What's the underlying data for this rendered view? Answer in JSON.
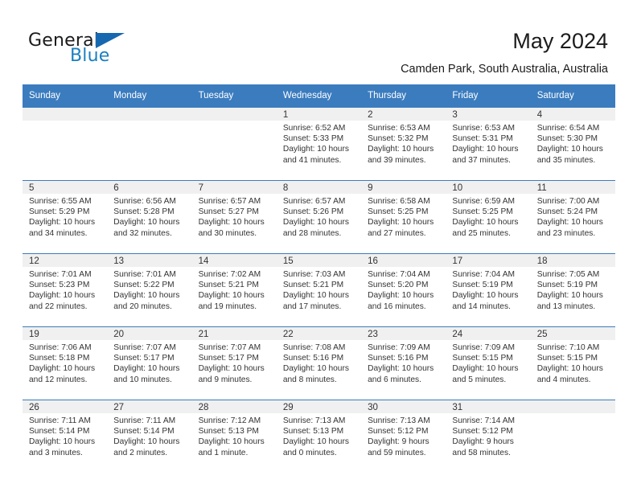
{
  "brand": {
    "word1": "General",
    "word2": "Blue",
    "triangle_color": "#1668b0",
    "blue_color": "#1a7fc1"
  },
  "header": {
    "title": "May 2024",
    "subtitle": "Camden Park, South Australia, Australia"
  },
  "theme": {
    "header_bar": "#3b7cbf",
    "daynum_band": "#f0f0f0",
    "text": "#333333"
  },
  "calendar": {
    "weekday_headers": [
      "Sunday",
      "Monday",
      "Tuesday",
      "Wednesday",
      "Thursday",
      "Friday",
      "Saturday"
    ],
    "weeks": [
      [
        {
          "day": "",
          "sunrise": "",
          "sunset": "",
          "daylight": ""
        },
        {
          "day": "",
          "sunrise": "",
          "sunset": "",
          "daylight": ""
        },
        {
          "day": "",
          "sunrise": "",
          "sunset": "",
          "daylight": ""
        },
        {
          "day": "1",
          "sunrise": "Sunrise: 6:52 AM",
          "sunset": "Sunset: 5:33 PM",
          "daylight": "Daylight: 10 hours and 41 minutes."
        },
        {
          "day": "2",
          "sunrise": "Sunrise: 6:53 AM",
          "sunset": "Sunset: 5:32 PM",
          "daylight": "Daylight: 10 hours and 39 minutes."
        },
        {
          "day": "3",
          "sunrise": "Sunrise: 6:53 AM",
          "sunset": "Sunset: 5:31 PM",
          "daylight": "Daylight: 10 hours and 37 minutes."
        },
        {
          "day": "4",
          "sunrise": "Sunrise: 6:54 AM",
          "sunset": "Sunset: 5:30 PM",
          "daylight": "Daylight: 10 hours and 35 minutes."
        }
      ],
      [
        {
          "day": "5",
          "sunrise": "Sunrise: 6:55 AM",
          "sunset": "Sunset: 5:29 PM",
          "daylight": "Daylight: 10 hours and 34 minutes."
        },
        {
          "day": "6",
          "sunrise": "Sunrise: 6:56 AM",
          "sunset": "Sunset: 5:28 PM",
          "daylight": "Daylight: 10 hours and 32 minutes."
        },
        {
          "day": "7",
          "sunrise": "Sunrise: 6:57 AM",
          "sunset": "Sunset: 5:27 PM",
          "daylight": "Daylight: 10 hours and 30 minutes."
        },
        {
          "day": "8",
          "sunrise": "Sunrise: 6:57 AM",
          "sunset": "Sunset: 5:26 PM",
          "daylight": "Daylight: 10 hours and 28 minutes."
        },
        {
          "day": "9",
          "sunrise": "Sunrise: 6:58 AM",
          "sunset": "Sunset: 5:25 PM",
          "daylight": "Daylight: 10 hours and 27 minutes."
        },
        {
          "day": "10",
          "sunrise": "Sunrise: 6:59 AM",
          "sunset": "Sunset: 5:25 PM",
          "daylight": "Daylight: 10 hours and 25 minutes."
        },
        {
          "day": "11",
          "sunrise": "Sunrise: 7:00 AM",
          "sunset": "Sunset: 5:24 PM",
          "daylight": "Daylight: 10 hours and 23 minutes."
        }
      ],
      [
        {
          "day": "12",
          "sunrise": "Sunrise: 7:01 AM",
          "sunset": "Sunset: 5:23 PM",
          "daylight": "Daylight: 10 hours and 22 minutes."
        },
        {
          "day": "13",
          "sunrise": "Sunrise: 7:01 AM",
          "sunset": "Sunset: 5:22 PM",
          "daylight": "Daylight: 10 hours and 20 minutes."
        },
        {
          "day": "14",
          "sunrise": "Sunrise: 7:02 AM",
          "sunset": "Sunset: 5:21 PM",
          "daylight": "Daylight: 10 hours and 19 minutes."
        },
        {
          "day": "15",
          "sunrise": "Sunrise: 7:03 AM",
          "sunset": "Sunset: 5:21 PM",
          "daylight": "Daylight: 10 hours and 17 minutes."
        },
        {
          "day": "16",
          "sunrise": "Sunrise: 7:04 AM",
          "sunset": "Sunset: 5:20 PM",
          "daylight": "Daylight: 10 hours and 16 minutes."
        },
        {
          "day": "17",
          "sunrise": "Sunrise: 7:04 AM",
          "sunset": "Sunset: 5:19 PM",
          "daylight": "Daylight: 10 hours and 14 minutes."
        },
        {
          "day": "18",
          "sunrise": "Sunrise: 7:05 AM",
          "sunset": "Sunset: 5:19 PM",
          "daylight": "Daylight: 10 hours and 13 minutes."
        }
      ],
      [
        {
          "day": "19",
          "sunrise": "Sunrise: 7:06 AM",
          "sunset": "Sunset: 5:18 PM",
          "daylight": "Daylight: 10 hours and 12 minutes."
        },
        {
          "day": "20",
          "sunrise": "Sunrise: 7:07 AM",
          "sunset": "Sunset: 5:17 PM",
          "daylight": "Daylight: 10 hours and 10 minutes."
        },
        {
          "day": "21",
          "sunrise": "Sunrise: 7:07 AM",
          "sunset": "Sunset: 5:17 PM",
          "daylight": "Daylight: 10 hours and 9 minutes."
        },
        {
          "day": "22",
          "sunrise": "Sunrise: 7:08 AM",
          "sunset": "Sunset: 5:16 PM",
          "daylight": "Daylight: 10 hours and 8 minutes."
        },
        {
          "day": "23",
          "sunrise": "Sunrise: 7:09 AM",
          "sunset": "Sunset: 5:16 PM",
          "daylight": "Daylight: 10 hours and 6 minutes."
        },
        {
          "day": "24",
          "sunrise": "Sunrise: 7:09 AM",
          "sunset": "Sunset: 5:15 PM",
          "daylight": "Daylight: 10 hours and 5 minutes."
        },
        {
          "day": "25",
          "sunrise": "Sunrise: 7:10 AM",
          "sunset": "Sunset: 5:15 PM",
          "daylight": "Daylight: 10 hours and 4 minutes."
        }
      ],
      [
        {
          "day": "26",
          "sunrise": "Sunrise: 7:11 AM",
          "sunset": "Sunset: 5:14 PM",
          "daylight": "Daylight: 10 hours and 3 minutes."
        },
        {
          "day": "27",
          "sunrise": "Sunrise: 7:11 AM",
          "sunset": "Sunset: 5:14 PM",
          "daylight": "Daylight: 10 hours and 2 minutes."
        },
        {
          "day": "28",
          "sunrise": "Sunrise: 7:12 AM",
          "sunset": "Sunset: 5:13 PM",
          "daylight": "Daylight: 10 hours and 1 minute."
        },
        {
          "day": "29",
          "sunrise": "Sunrise: 7:13 AM",
          "sunset": "Sunset: 5:13 PM",
          "daylight": "Daylight: 10 hours and 0 minutes."
        },
        {
          "day": "30",
          "sunrise": "Sunrise: 7:13 AM",
          "sunset": "Sunset: 5:12 PM",
          "daylight": "Daylight: 9 hours and 59 minutes."
        },
        {
          "day": "31",
          "sunrise": "Sunrise: 7:14 AM",
          "sunset": "Sunset: 5:12 PM",
          "daylight": "Daylight: 9 hours and 58 minutes."
        },
        {
          "day": "",
          "sunrise": "",
          "sunset": "",
          "daylight": ""
        }
      ]
    ]
  }
}
